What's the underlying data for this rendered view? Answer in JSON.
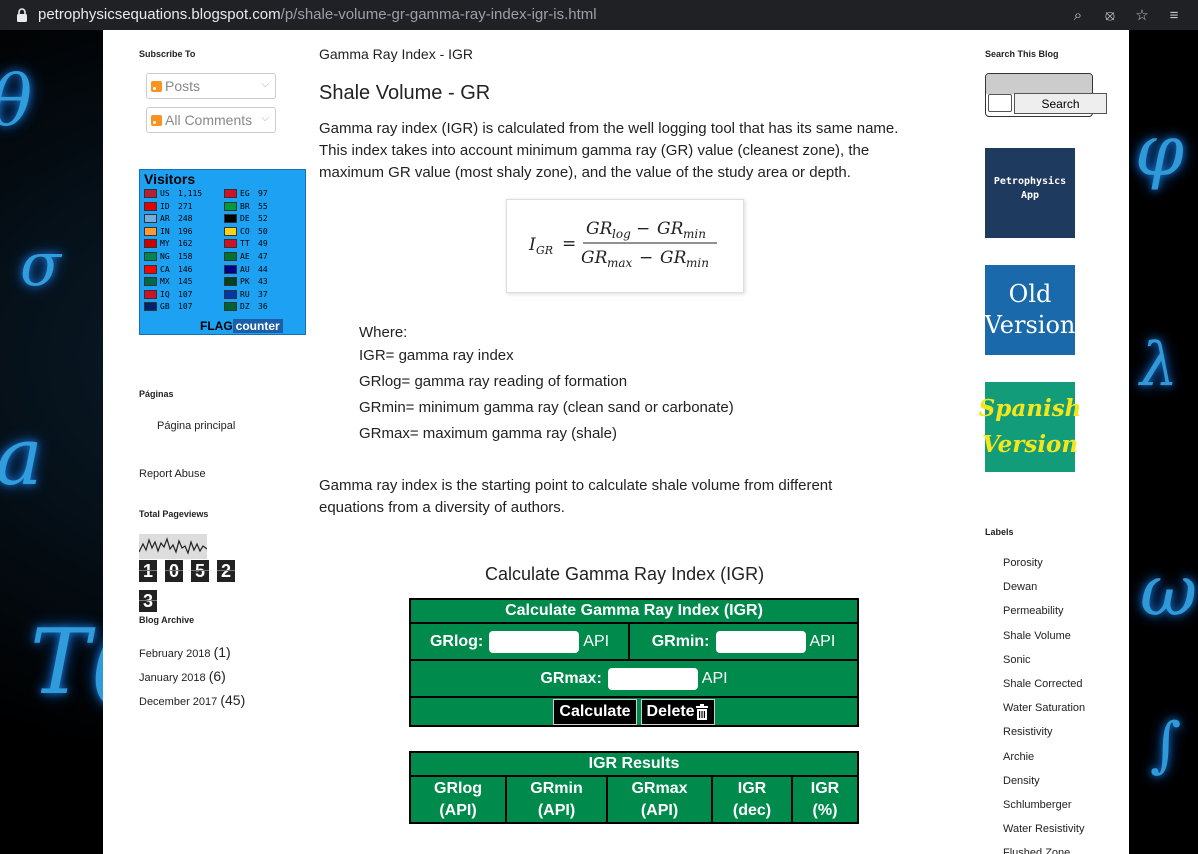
{
  "browser": {
    "url_host": "petrophysicsequations.blogspot.com",
    "url_path": "/p/shale-volume-gr-gamma-ray-index-igr-is.html",
    "icons": [
      "zoom-icon",
      "eye-off-icon",
      "star-icon",
      "reading-list-icon"
    ]
  },
  "left": {
    "subscribe_title": "Subscribe To",
    "subscribe_posts": "Posts",
    "subscribe_comments": "All Comments",
    "visitors_title": "Visitors",
    "flags": [
      {
        "code": "US",
        "count": "1,115"
      },
      {
        "code": "ID",
        "count": "271"
      },
      {
        "code": "AR",
        "count": "248"
      },
      {
        "code": "IN",
        "count": "196"
      },
      {
        "code": "MY",
        "count": "162"
      },
      {
        "code": "NG",
        "count": "158"
      },
      {
        "code": "CA",
        "count": "146"
      },
      {
        "code": "MX",
        "count": "145"
      },
      {
        "code": "IQ",
        "count": "107"
      },
      {
        "code": "GB",
        "count": "107"
      },
      {
        "code": "EG",
        "count": "97"
      },
      {
        "code": "BR",
        "count": "55"
      },
      {
        "code": "DE",
        "count": "52"
      },
      {
        "code": "CO",
        "count": "50"
      },
      {
        "code": "TT",
        "count": "49"
      },
      {
        "code": "AE",
        "count": "47"
      },
      {
        "code": "AU",
        "count": "44"
      },
      {
        "code": "PK",
        "count": "43"
      },
      {
        "code": "RU",
        "count": "37"
      },
      {
        "code": "DZ",
        "count": "36"
      }
    ],
    "flag_brand": "FLAG",
    "flag_brand2": "counter",
    "pages_title": "Páginas",
    "pages_link": "Página principal",
    "report_abuse": "Report Abuse",
    "pageviews_title": "Total Pageviews",
    "pageview_digits": [
      "1",
      "0",
      "5",
      "2",
      "3"
    ],
    "archive_title": "Blog Archive",
    "archive": [
      {
        "month": "February 2018",
        "count": "(1)"
      },
      {
        "month": "January 2018",
        "count": "(6)"
      },
      {
        "month": "December 2017",
        "count": "(45)"
      }
    ]
  },
  "main": {
    "breadcrumb": "Gamma Ray Index - IGR",
    "title": "Shale Volume - GR",
    "intro_lines": [
      "Gamma ray index (IGR) is calculated from the well logging tool that has its same name.",
      "This index takes into account minimum gamma ray (GR) value (cleanest zone), the",
      "maximum GR value (most shaly zone), and the value of the study area or depth."
    ],
    "where": [
      "Where:",
      "IGR= gamma ray index",
      "GRlog= gamma ray reading of formation",
      "GRmin= minimum gamma ray (clean sand or carbonate)",
      "GRmax= maximum gamma ray (shale)"
    ],
    "outro_lines": [
      "Gamma ray index is the starting point to calculate shale volume from different",
      "equations from a diversity of authors."
    ],
    "calc_title": "Calculate Gamma Ray Index (IGR)",
    "calc_header": "Calculate Gamma Ray Index (IGR)",
    "grlog_label": "GRlog:",
    "grmin_label": "GRmin:",
    "grmax_label": "GRmax:",
    "unit": "API",
    "calculate_btn": "Calculate",
    "delete_btn": "Delete",
    "results_header": "IGR Results",
    "results_cols": [
      {
        "line1": "GRlog",
        "line2": "(API)"
      },
      {
        "line1": "GRmin",
        "line2": "(API)"
      },
      {
        "line1": "GRmax",
        "line2": "(API)"
      },
      {
        "line1": "IGR",
        "line2": "(dec)"
      },
      {
        "line1": "IGR",
        "line2": "(%)"
      }
    ]
  },
  "right": {
    "search_title": "Search This Blog",
    "search_btn": "Search",
    "app_tile_line1": "Petrophysics",
    "app_tile_line2": "App",
    "old_tile_line1": "Old",
    "old_tile_line2": "Version",
    "spanish_tile_line1": "Spanish",
    "spanish_tile_line2": "Version",
    "labels_title": "Labels",
    "labels": [
      "Porosity",
      "Dewan",
      "Permeability",
      "Shale Volume",
      "Sonic",
      "Shale Corrected",
      "Water Saturation",
      "Resistivity",
      "Archie",
      "Density",
      "Schlumberger",
      "Water Resistivity",
      "Flushed Zone"
    ]
  }
}
